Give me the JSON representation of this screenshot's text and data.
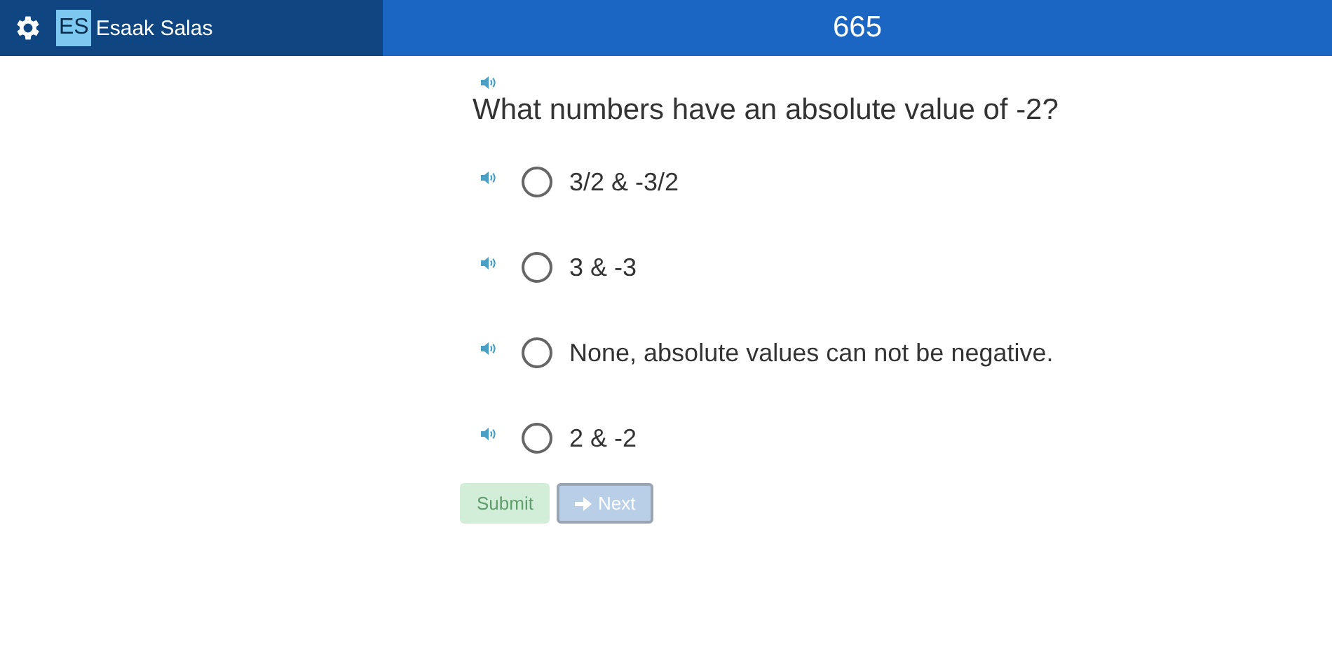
{
  "header": {
    "user_initials": "ES",
    "user_name": "Esaak Salas",
    "score": "665"
  },
  "question": {
    "text": "What numbers have an absolute value of -2?"
  },
  "options": [
    {
      "label": "3/2 & -3/2",
      "selected": false
    },
    {
      "label": "3 & -3",
      "selected": false
    },
    {
      "label": "None, absolute values can not be negative.",
      "selected": false
    },
    {
      "label": "2 & -2",
      "selected": false
    }
  ],
  "buttons": [
    {
      "kind": "submit",
      "label": "Submit",
      "disabled": true
    },
    {
      "kind": "next",
      "label": "Next",
      "disabled": true
    }
  ]
}
